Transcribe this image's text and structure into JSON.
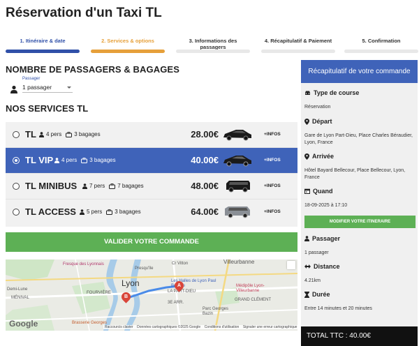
{
  "page": {
    "title": "Réservation d'un Taxi TL"
  },
  "stepper": [
    {
      "label": "1. Itinéraire & date",
      "color": "#3050a8",
      "bar": "#3050a8"
    },
    {
      "label": "2. Services & options",
      "color": "#e6a03a",
      "bar": "#e6a03a"
    },
    {
      "label": "3. Informations des passagers",
      "color": "#333333",
      "bar": "#e8e8e8"
    },
    {
      "label": "4. Récapitulatif & Paiement",
      "color": "#333333",
      "bar": "#e8e8e8"
    },
    {
      "label": "5. Confirmation",
      "color": "#333333",
      "bar": "#e8e8e8"
    }
  ],
  "passengers": {
    "section_title": "NOMBRE DE PASSAGERS & BAGAGES",
    "field_label": "Passager",
    "selected_value": "1 passager",
    "icon": "person-icon"
  },
  "services": {
    "section_title": "NOS SERVICES TL",
    "items": [
      {
        "name": "TL",
        "persons": "4 pers",
        "bags": "3 bagages",
        "price": "28.00€",
        "infos": "+INFOS",
        "selected": false
      },
      {
        "name": "TL VIP",
        "persons": "4 pers",
        "bags": "3 bagages",
        "price": "40.00€",
        "infos": "+INFOS",
        "selected": true
      },
      {
        "name": "TL MINIBUS",
        "persons": "7 pers",
        "bags": "7 bagages",
        "price": "48.00€",
        "infos": "+INFOS",
        "selected": false
      },
      {
        "name": "TL ACCESS",
        "persons": "5 pers",
        "bags": "3 bagages",
        "price": "64.00€",
        "infos": "+INFOS",
        "selected": false
      }
    ]
  },
  "validate_button": "VALIDER VOTRE COMMANDE",
  "map": {
    "city_label": "Lyon",
    "labels": {
      "presquile": "Presqu'île",
      "villeurbanne": "Villeurbanne",
      "fresque": "Fresque des Lyonnais",
      "fourviere": "FOURVIÈRE",
      "halles": "Les Halles de Lyon Paul Bocuse",
      "part_dieu": "LA PART-DIEU",
      "arr3": "3E ARR.",
      "grand_clement": "GRAND CLÉMENT",
      "medipole": "Médipôle Lyon-Villeurbanne",
      "parc": "Parc Georges Bazin",
      "brasserie": "Brasserie Georges",
      "demi_lune": "Demi-Lune",
      "menival": "MÉNIVAL",
      "vitton": "Cr Vitton",
      "pin_a": "A",
      "pin_b": "B"
    },
    "logo": "Google",
    "footer_shortcuts": "Raccourcis clavier",
    "footer_data": "Données cartographiques ©2025 Google",
    "footer_terms": "Conditions d'utilisation",
    "footer_report": "Signaler une erreur cartographique"
  },
  "recap": {
    "header": "Récapitulatif de votre commande",
    "course_type": {
      "label": "Type de course",
      "value": "Réservation",
      "icon": "car-icon"
    },
    "departure": {
      "label": "Départ",
      "value": "Gare de Lyon Part-Dieu, Place Charles Béraudier, Lyon, France",
      "icon": "pin-icon"
    },
    "arrival": {
      "label": "Arrivée",
      "value": "Hôtel Bayard Bellecour, Place Bellecour, Lyon, France",
      "icon": "pin-icon"
    },
    "when": {
      "label": "Quand",
      "value": "18-09-2025 à 17:10",
      "icon": "calendar-icon"
    },
    "modify_button": "MODIFIER VOTRE ITINERAIRE",
    "passenger": {
      "label": "Passager",
      "value": "1 passager",
      "icon": "person-icon"
    },
    "distance": {
      "label": "Distance",
      "value": "4.21km",
      "icon": "arrows-icon"
    },
    "duration": {
      "label": "Durée",
      "value": "Entre 14 minutes et 20 minutes",
      "icon": "hourglass-icon"
    },
    "total": "TOTAL TTC : 40.00€"
  },
  "colors": {
    "primary_blue": "#3f63b9",
    "green": "#5db055",
    "orange": "#e6a03a",
    "dark": "#111111"
  }
}
